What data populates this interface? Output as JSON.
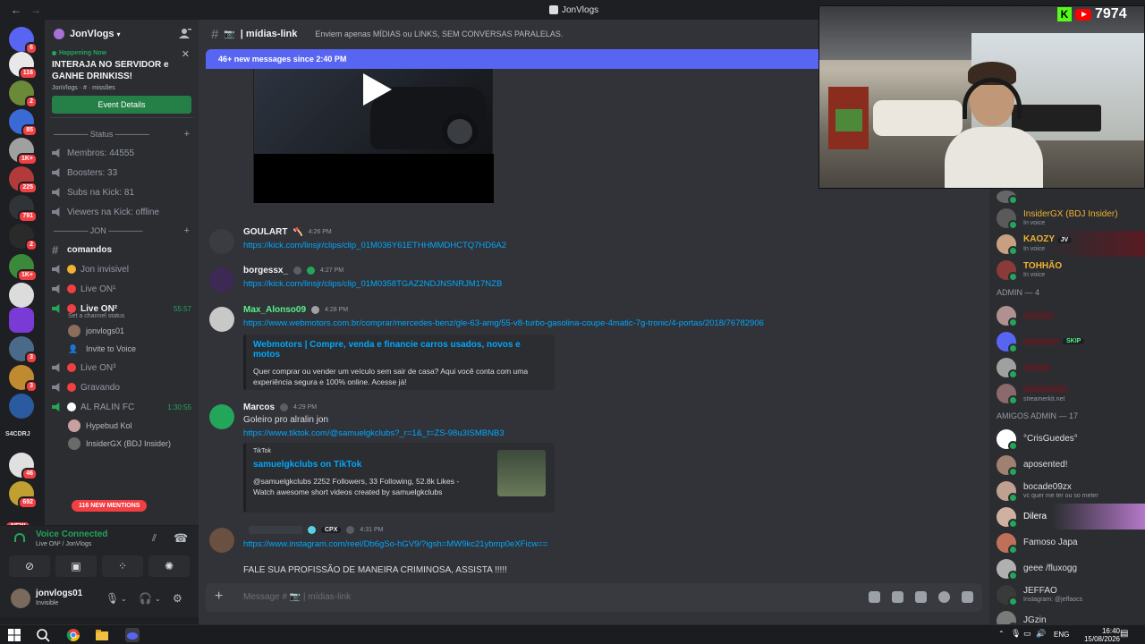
{
  "window": {
    "title": "JonVlogs"
  },
  "guild": {
    "name": "JonVlogs",
    "event": {
      "status": "Happening Now",
      "title_line1": "INTERAJA NO SERVIDOR e",
      "title_line2": "GANHE DRINKISS!",
      "location": "JonVlogs  ·  #  ·  missões",
      "button": "Event Details"
    },
    "categories": [
      {
        "label": "────── Status ──────"
      },
      {
        "label": "────── JON ──────"
      }
    ],
    "stat_channels": [
      "Membros: 44555",
      "Boosters: 33",
      "Subs na Kick: 81",
      "Viewers na Kick: offline"
    ],
    "channels": [
      {
        "name": "comandos"
      },
      {
        "name": "Jon invisivel"
      },
      {
        "name": "Live ON¹"
      },
      {
        "name": "Live ON²",
        "time": "55:57",
        "status": "Set a channel status"
      },
      {
        "name": "Live ON³"
      },
      {
        "name": "Gravando"
      },
      {
        "name": "AL RALIN FC",
        "time": "1:30:55"
      }
    ],
    "voice_users_live": [
      "jonvlogs01",
      "Invite to Voice"
    ],
    "voice_users_ralin": [
      "Hypebud Kol",
      "InsiderGX (BDJ Insider)"
    ],
    "mentions": "116 NEW MENTIONS"
  },
  "servers": {
    "badges": [
      "6",
      "116",
      "2",
      "85",
      "1K+",
      "225",
      "791",
      "2",
      "1K+",
      "3",
      "3",
      "46",
      "692"
    ],
    "text_label": "S4CDRJ",
    "new_label": "NEW"
  },
  "voice_panel": {
    "status": "Voice Connected",
    "sub": "Live ON² / JonVlogs"
  },
  "user_panel": {
    "name": "jonvlogs01",
    "status": "Invisible"
  },
  "channel": {
    "name": "| mídias-link",
    "topic": "Enviem apenas MÍDIAS ou LINKS, SEM CONVERSAS PARALELAS.",
    "new_messages": "46+ new messages since 2:40 PM",
    "input_placeholder": "Message # 📷 | mídias-link"
  },
  "messages": [
    {
      "user": "GOULART",
      "time": "4:26 PM",
      "link": "https://kick.com/linsjr/clips/clip_01M036Y61ETHHMMDHCTQ7HD6A2"
    },
    {
      "user": "borgessx_",
      "time": "4:27 PM",
      "link": "https://kick.com/linsjr/clips/clip_01M0358TGAZ2NDJNSNRJM17NZB"
    },
    {
      "user": "Max_Alonso09",
      "time": "4:28 PM",
      "link": "https://www.webmotors.com.br/comprar/mercedes-benz/gle-63-amg/55-v8-turbo-gasolina-coupe-4matic-7g-tronic/4-portas/2018/76782906",
      "embed_title": "Webmotors | Compre, venda e financie carros usados, novos e motos",
      "embed_desc1": "Quer comprar ou vender um veículo sem sair de casa? Aqui você conta com uma",
      "embed_desc2": "experiência segura e 100% online. Acesse já!"
    },
    {
      "user": "Marcos",
      "time": "4:29 PM",
      "text": "Goleiro pro alralin jon",
      "link": "https://www.tiktok.com/@samuelgkclubs?_r=1&_t=ZS-98u3ISMBNB3",
      "embed_provider": "TikTok",
      "embed_title": "samuelgkclubs on TikTok",
      "embed_desc1": "@samuelgkclubs 2252 Followers, 33 Following, 52.8k Likes -",
      "embed_desc2": "Watch awesome short videos created by samuelgkclubs"
    },
    {
      "user": "",
      "tag": "CPX",
      "time": "4:31 PM",
      "link": "https://www.instagram.com/reel/Db6gSo-hGV9/?igsh=MW9kc21ybmp0eXFicw==",
      "text": "FALE SUA PROFISSÃO DE MANEIRA CRIMINOSA, ASSISTA !!!!!"
    }
  ],
  "overlay": {
    "count": "7974"
  },
  "members": {
    "voice": [
      {
        "name": "InsiderGX (BDJ Insider)",
        "sub": "In voice",
        "color": "#f0b232"
      },
      {
        "name": "KAOZY",
        "tag": "JV",
        "sub": "In voice",
        "color": "#f0b232"
      },
      {
        "name": "TOHHÃO",
        "sub": "In voice",
        "color": "#f0b232"
      }
    ],
    "admin_header": "ADMIN — 4",
    "admins": [
      {
        "name": "",
        "tag": "",
        "sub": ""
      },
      {
        "name": "",
        "tag": "SKIP",
        "sub": ""
      },
      {
        "name": "",
        "tag": "",
        "sub": ""
      },
      {
        "name": "",
        "tag": "",
        "sub": "streamerkit.net"
      }
    ],
    "friends_header": "AMIGOS ADMIN — 17",
    "friends": [
      {
        "name": "°CrisGuedes°",
        "sub": ""
      },
      {
        "name": "aposented!",
        "sub": ""
      },
      {
        "name": "bocade09zx",
        "sub": "vc quer me ter ou so meter"
      },
      {
        "name": "Dilera",
        "sub": ""
      },
      {
        "name": "Famoso Japa",
        "sub": ""
      },
      {
        "name": "geee /fluxogg",
        "sub": ""
      },
      {
        "name": "JEFFAO",
        "sub": "Instagram: @jeffaocs"
      },
      {
        "name": "JGzin",
        "sub": ""
      }
    ]
  },
  "taskbar": {
    "lang": "ENG",
    "time": "16:40",
    "date": "15/08/2026"
  }
}
